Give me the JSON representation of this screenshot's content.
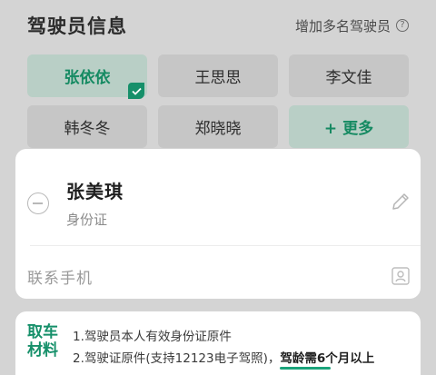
{
  "header": {
    "title": "驾驶员信息",
    "add_link": "增加多名驾驶员",
    "help_icon": "question-circle-icon"
  },
  "drivers": [
    {
      "label": "张依依",
      "selected": true
    },
    {
      "label": "王思思",
      "selected": false
    },
    {
      "label": "李文佳",
      "selected": false
    },
    {
      "label": "韩冬冬",
      "selected": false
    },
    {
      "label": "郑晓晓",
      "selected": false
    }
  ],
  "more_button": {
    "label": "+ 更多"
  },
  "form_card": {
    "name": "张美琪",
    "id_type": "身份证",
    "phone_label": "联系手机",
    "icons": [
      "minus-circle-icon",
      "edit-pencil-icon",
      "contact-card-icon"
    ]
  },
  "materials": {
    "title": "取车材料",
    "line1": "1.驾驶员本人有效身份证原件",
    "line2_prefix": "2.驾驶证原件(支持12123电子驾照)，",
    "line2_emphasis": "驾龄需6个月以上"
  },
  "colors": {
    "accent": "#16906a",
    "selected_bg": "#b9cfc6",
    "overlay_bg": "#d4d4d4"
  }
}
